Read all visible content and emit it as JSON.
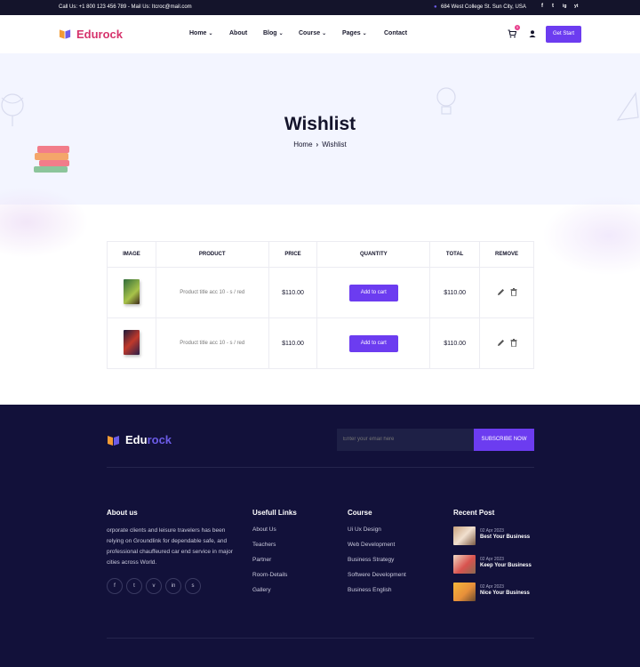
{
  "topbar": {
    "contact": "Call Us: +1 800 123 456 789 - Mail Us: Itcroc@mail.com",
    "address": "684 West College St. Sun City, USA",
    "social": [
      "f",
      "t",
      "ig",
      "yt"
    ]
  },
  "header": {
    "logo_text": "Edurock",
    "nav": [
      {
        "label": "Home",
        "dropdown": true
      },
      {
        "label": "About",
        "dropdown": false
      },
      {
        "label": "Blog",
        "dropdown": true
      },
      {
        "label": "Course",
        "dropdown": true
      },
      {
        "label": "Pages",
        "dropdown": true
      },
      {
        "label": "Contact",
        "dropdown": false
      }
    ],
    "cart_count": "0",
    "cta": "Get Start"
  },
  "hero": {
    "title": "Wishlist",
    "crumb_home": "Home",
    "crumb_current": "Wishlist"
  },
  "wishlist": {
    "headers": [
      "IMAGE",
      "PRODUCT",
      "PRICE",
      "QUANTITY",
      "TOTAL",
      "REMOVE"
    ],
    "rows": [
      {
        "product": "Product title acc 10 - s / red",
        "price": "$110.00",
        "action": "Add to cart",
        "total": "$110.00"
      },
      {
        "product": "Product title acc 10 - s / red",
        "price": "$110.00",
        "action": "Add to cart",
        "total": "$110.00"
      }
    ]
  },
  "footer": {
    "logo_a": "Edu",
    "logo_b": "rock",
    "email_placeholder": "Enter your email here",
    "subscribe": "SUBSCRIBE NOW",
    "about_title": "About us",
    "about_text": "orporate clients and leisure travelers has been relying on Groundlink for dependable safe, and professional chauffeured car end service in major cities across World.",
    "links_title": "Usefull Links",
    "links": [
      "About Us",
      "Teachers",
      "Partner",
      "Room-Details",
      "Gallery"
    ],
    "course_title": "Course",
    "courses": [
      "Ui Ux Design",
      "Web Development",
      "Business Strategy",
      "Softwere Development",
      "Business English"
    ],
    "posts_title": "Recent Post",
    "posts": [
      {
        "date": "02 Apr 2023",
        "title": "Best Your Business"
      },
      {
        "date": "02 Apr 2023",
        "title": "Keep Your Business"
      },
      {
        "date": "02 Apr 2023",
        "title": "Nice Your Business"
      }
    ]
  },
  "colors": {
    "primary": "#6c3cf0",
    "footer_bg": "#12113a",
    "topbar_bg": "#14142b",
    "logo_pink": "#d6336c"
  }
}
